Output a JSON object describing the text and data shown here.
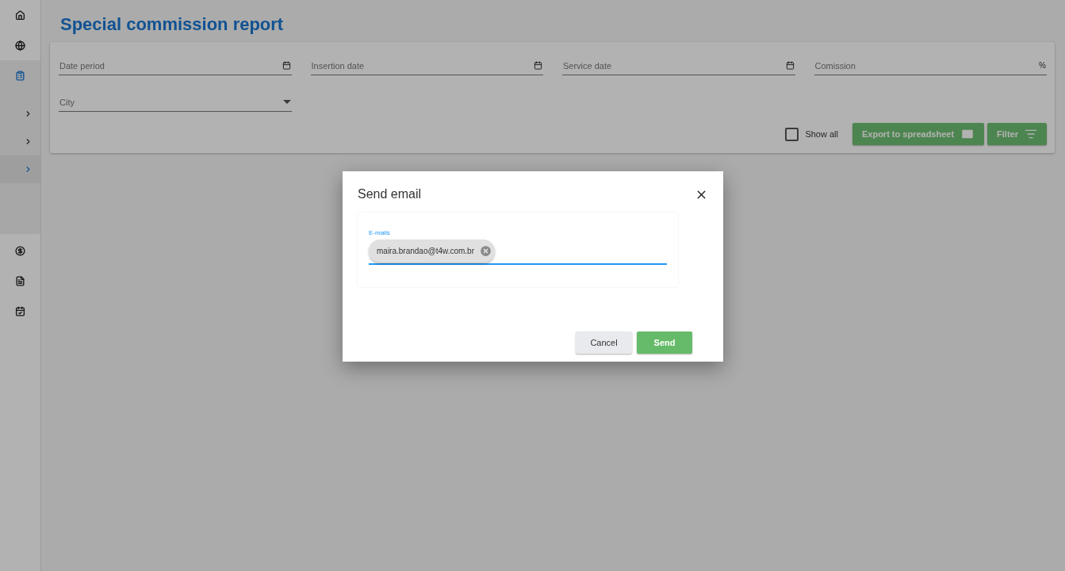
{
  "page": {
    "title": "Special commission report"
  },
  "sidebar": {
    "top_items": [
      {
        "selected": false
      },
      {
        "selected": false
      },
      {
        "selected": true
      }
    ],
    "submenu": [
      {
        "selected": false
      },
      {
        "selected": false
      },
      {
        "selected": true
      }
    ],
    "bottom_items": [
      {
        "selected": false
      },
      {
        "selected": false
      },
      {
        "selected": false
      }
    ]
  },
  "filters": {
    "fields": [
      {
        "kind": "date",
        "label": "Date period"
      },
      {
        "kind": "date",
        "label": "Insertion date"
      },
      {
        "kind": "date",
        "label": "Service date"
      },
      {
        "kind": "percent",
        "label": "Comission",
        "suffix": "%"
      },
      {
        "kind": "select",
        "label": "City"
      }
    ],
    "show_all": {
      "label": "Show all",
      "checked": false
    },
    "export_button": "Export to spreadsheet",
    "filter_button": "Filter"
  },
  "dialog": {
    "title": "Send email",
    "field": {
      "label": "E-mails",
      "focused": true,
      "chips": [
        "maira.brandao@t4w.com.br"
      ]
    },
    "cancel_button": "Cancel",
    "send_button": "Send"
  }
}
